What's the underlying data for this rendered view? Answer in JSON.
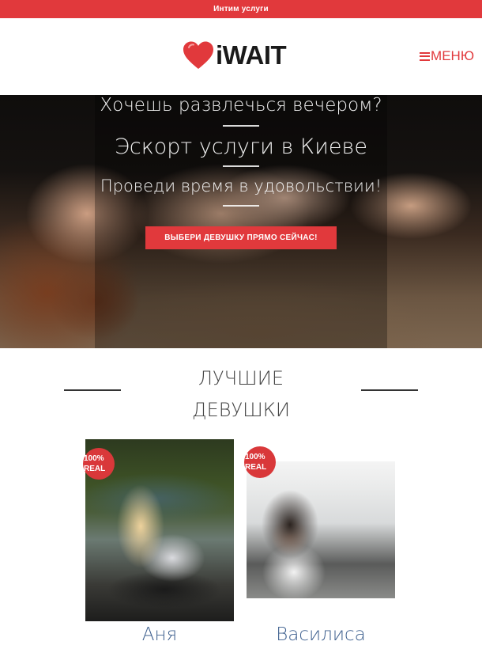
{
  "topbar": {
    "text": "Интим услуги"
  },
  "header": {
    "logo_text": "iWAIT",
    "menu_label": "МЕНЮ"
  },
  "hero": {
    "line1": "Хочешь развлечься вечером?",
    "line2": "Эскорт услуги в Киеве",
    "line3": "Проведи время в удовольствии!",
    "cta_label": "ВЫБЕРИ ДЕВУШКУ ПРЯМО СЕЙЧАС!"
  },
  "section": {
    "title_line1": "ЛУЧШИЕ",
    "title_line2": "ДЕВУШКИ"
  },
  "cards": [
    {
      "name": "Аня",
      "badge_line1": "100%",
      "badge_line2": "REAL"
    },
    {
      "name": "Василиса",
      "badge_line1": "100%",
      "badge_line2": "REAL"
    }
  ],
  "colors": {
    "accent": "#e1393c",
    "name_link": "#3d5f8e"
  },
  "icons": [
    "heart-logo-icon",
    "hamburger-menu-icon"
  ]
}
